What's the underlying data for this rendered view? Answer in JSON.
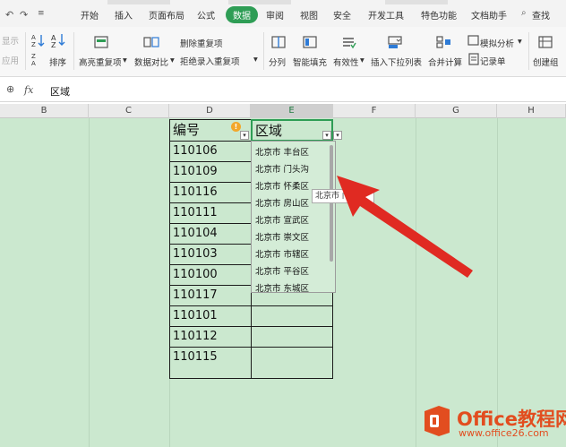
{
  "quick_access": {
    "undo": "↶",
    "redo": "↷",
    "more": "≡"
  },
  "menu": {
    "tabs": [
      {
        "label": "开始"
      },
      {
        "label": "插入"
      },
      {
        "label": "页面布局"
      },
      {
        "label": "公式"
      },
      {
        "label": "数据"
      },
      {
        "label": "审阅"
      },
      {
        "label": "视图"
      },
      {
        "label": "安全"
      },
      {
        "label": "开发工具"
      },
      {
        "label": "特色功能"
      },
      {
        "label": "文档助手"
      }
    ],
    "active_index": 4,
    "search_label": "查找"
  },
  "ribbon": {
    "show_label": "显示",
    "apply_label": "应用",
    "sort_label": "排序",
    "highlight_dup_label": "高亮重复项",
    "data_compare_label": "数据对比",
    "remove_dup_label": "删除重复项",
    "reject_dup_label": "拒绝录入重复项",
    "split_label": "分列",
    "smart_fill_label": "智能填充",
    "validity_label": "有效性",
    "insert_dropdown_label": "插入下拉列表",
    "merge_calc_label": "合并计算",
    "simulate_label": "模拟分析",
    "record_label": "记录单",
    "create_group_label": "创建组"
  },
  "formula_bar": {
    "fx_label": "fx",
    "value": "区域"
  },
  "columns": [
    "B",
    "C",
    "D",
    "E",
    "F",
    "G",
    "H"
  ],
  "selected_column": "E",
  "table": {
    "header_id": "编号",
    "header_region": "区域",
    "ids": [
      "110106",
      "110109",
      "110116",
      "110111",
      "110104",
      "110103",
      "110100",
      "110117",
      "110101",
      "110112",
      "110115"
    ]
  },
  "dropdown": {
    "options": [
      "北京市 丰台区",
      "北京市 门头沟",
      "北京市 怀柔区",
      "北京市 房山区",
      "北京市 宣武区",
      "北京市 崇文区",
      "北京市 市辖区",
      "北京市 平谷区",
      "北京市 东城区"
    ],
    "tooltip": "北京市 门头"
  },
  "watermark": {
    "title": "Office教程网",
    "url": "www.office26.com"
  },
  "colors": {
    "accent": "#2e9d55",
    "sheet": "#cbe8cf",
    "arrow": "#e02a22",
    "watermark": "#e24d1f"
  }
}
